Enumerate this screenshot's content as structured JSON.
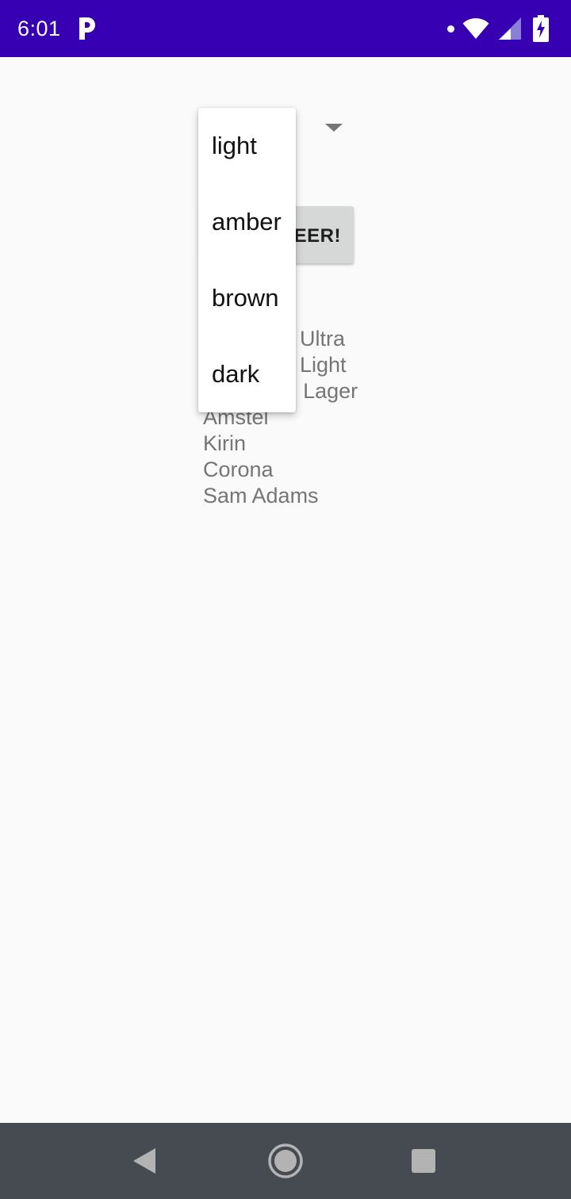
{
  "status_bar": {
    "time": "6:01",
    "app_notification_icon": "parking-p-icon",
    "icons": [
      "notification-dot-icon",
      "wifi-icon",
      "cell-signal-icon",
      "battery-charging-icon"
    ],
    "background_color": "#3700b3"
  },
  "spinner": {
    "arrow_icon": "dropdown-arrow-icon",
    "options": [
      "light",
      "amber",
      "brown",
      "dark"
    ],
    "expanded": true
  },
  "find_button": {
    "visible_label": "EER!"
  },
  "brands": {
    "partial_lines": [
      "Ultra",
      "Light"
    ],
    "items": [
      "Yuengling Lager",
      "Amstel",
      "Kirin",
      "Corona",
      "Sam Adams"
    ]
  },
  "nav_bar": {
    "icons": [
      "back-icon",
      "home-icon",
      "recents-icon"
    ],
    "background_color": "#454b51"
  }
}
